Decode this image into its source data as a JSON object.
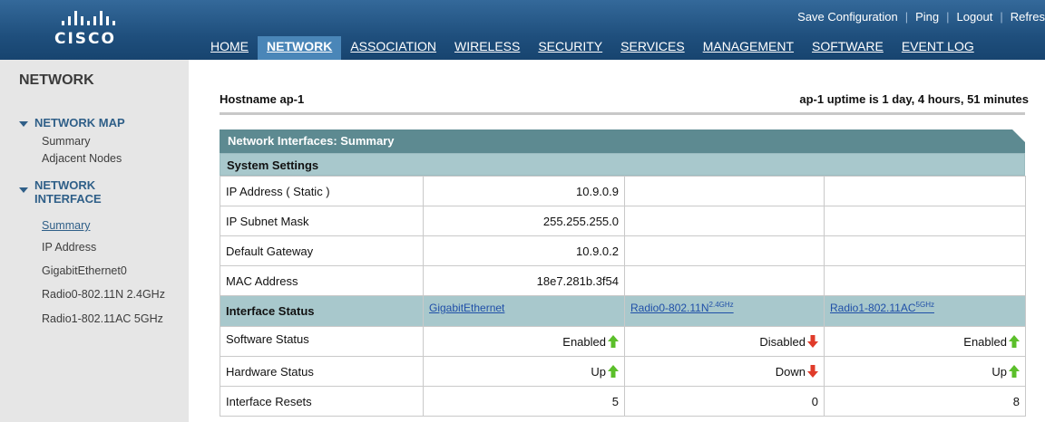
{
  "header": {
    "logo_text": "CISCO",
    "top_links": [
      "Save Configuration",
      "Ping",
      "Logout",
      "Refres"
    ],
    "tabs": [
      "HOME",
      "NETWORK",
      "ASSOCIATION",
      "WIRELESS",
      "SECURITY",
      "SERVICES",
      "MANAGEMENT",
      "SOFTWARE",
      "EVENT LOG"
    ],
    "active_tab": "NETWORK"
  },
  "sidebar": {
    "title": "NETWORK",
    "network_map": {
      "label": "NETWORK MAP",
      "items": [
        "Summary",
        "Adjacent Nodes"
      ]
    },
    "network_interface": {
      "label_line1": "NETWORK",
      "label_line2": "INTERFACE",
      "items": [
        "Summary",
        "IP Address",
        "GigabitEthernet0",
        "Radio0-802.11N 2.4GHz",
        "Radio1-802.11AC 5GHz"
      ]
    }
  },
  "main": {
    "hostname": "Hostname  ap-1",
    "uptime": "ap-1 uptime is 1 day, 4 hours, 51 minutes",
    "panel_title": "Network Interfaces: Summary",
    "system_settings": "System Settings",
    "rows": [
      {
        "label": "IP Address ( Static )",
        "value": "10.9.0.9"
      },
      {
        "label": "IP Subnet Mask",
        "value": "255.255.255.0"
      },
      {
        "label": "Default Gateway",
        "value": "10.9.0.2"
      },
      {
        "label": "MAC Address",
        "value": "18e7.281b.3f54"
      }
    ],
    "interface_status": {
      "label": "Interface Status",
      "gig": "GigabitEthernet",
      "radio0": "Radio0-802.11N",
      "radio0_sup": "2.4GHz",
      "radio1": "Radio1-802.11AC",
      "radio1_sup": "5GHz"
    },
    "software_status": {
      "label": "Software Status",
      "values": [
        "Enabled",
        "Disabled",
        "Enabled"
      ]
    },
    "hardware_status": {
      "label": "Hardware Status",
      "values": [
        "Up",
        "Down",
        "Up"
      ]
    },
    "interface_resets": {
      "label": "Interface Resets",
      "values": [
        "5",
        "0",
        "8"
      ]
    }
  },
  "colors": {
    "header": "#1f4f7d",
    "active_tab": "#4a86b8",
    "status_up": "#5bbf2a",
    "status_down": "#e03b2a",
    "table_header": "#a8c8cc"
  },
  "icons": {
    "up": "green-up-arrow-icon",
    "down": "red-down-arrow-icon"
  }
}
